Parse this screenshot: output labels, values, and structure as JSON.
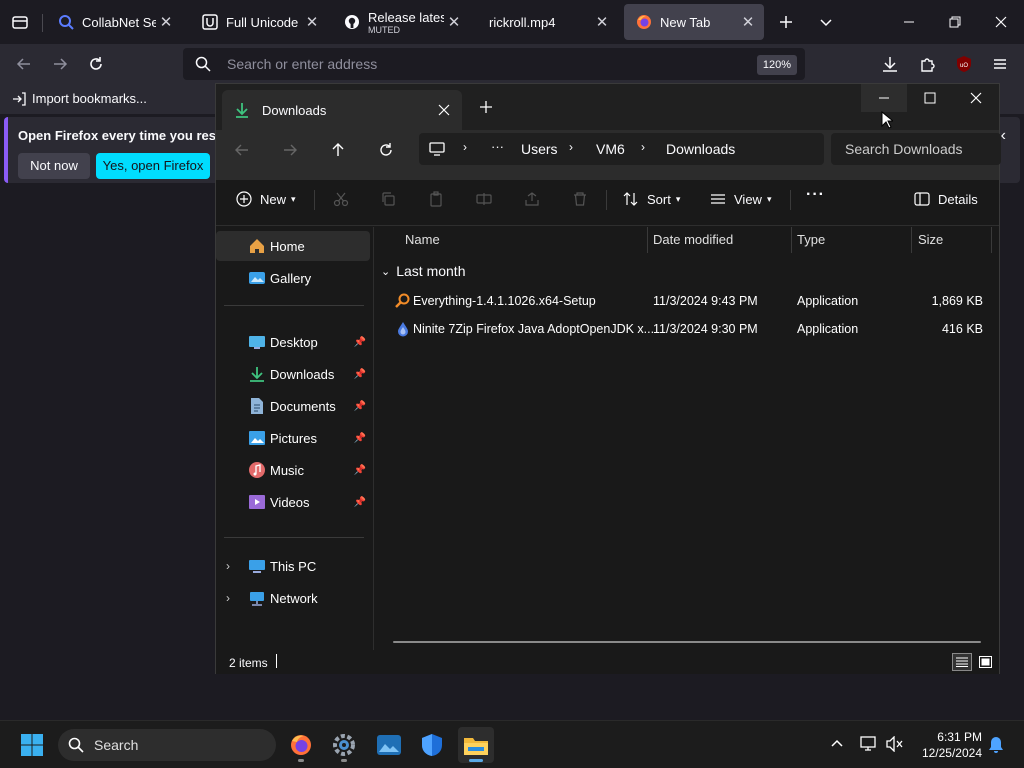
{
  "browser": {
    "tabs": [
      {
        "title": "CollabNet Sear",
        "icon": "search-icon",
        "active": false
      },
      {
        "title": "Full Unicode Inp",
        "icon": "unicode-icon",
        "active": false
      },
      {
        "title": "Release latest · S",
        "subtitle": "MUTED",
        "icon": "github-icon",
        "active": false
      },
      {
        "title": "rickroll.mp4",
        "icon": "",
        "active": false
      },
      {
        "title": "New Tab",
        "icon": "firefox-icon",
        "active": true
      }
    ],
    "address_placeholder": "Search or enter address",
    "zoom": "120%",
    "import_bookmarks": "Import bookmarks...",
    "notification": {
      "text": "Open Firefox every time you restar",
      "not_now": "Not now",
      "yes_open": "Yes, open Firefox"
    },
    "colors": {
      "accent": "#00ddff",
      "chrome": "#2b2a33",
      "tabstrip": "#1c1b22"
    }
  },
  "explorer": {
    "tab_title": "Downloads",
    "breadcrumbs": [
      "Users",
      "VM6",
      "Downloads"
    ],
    "search_placeholder": "Search Downloads",
    "toolbar": {
      "new": "New",
      "sort": "Sort",
      "view": "View",
      "details": "Details"
    },
    "nav": {
      "home": "Home",
      "gallery": "Gallery",
      "quick": [
        {
          "label": "Desktop",
          "icon": "desktop-icon"
        },
        {
          "label": "Downloads",
          "icon": "downloads-icon"
        },
        {
          "label": "Documents",
          "icon": "documents-icon"
        },
        {
          "label": "Pictures",
          "icon": "pictures-icon"
        },
        {
          "label": "Music",
          "icon": "music-icon"
        },
        {
          "label": "Videos",
          "icon": "videos-icon"
        }
      ],
      "this_pc": "This PC",
      "network": "Network"
    },
    "columns": {
      "name": "Name",
      "date": "Date modified",
      "type": "Type",
      "size": "Size"
    },
    "group": "Last month",
    "files": [
      {
        "name": "Everything-1.4.1.1026.x64-Setup",
        "date": "11/3/2024 9:43 PM",
        "type": "Application",
        "size": "1,869 KB",
        "icon": "everything-icon"
      },
      {
        "name": "Ninite 7Zip Firefox Java AdoptOpenJDK x...",
        "date": "11/3/2024 9:30 PM",
        "type": "Application",
        "size": "416 KB",
        "icon": "ninite-icon"
      }
    ],
    "status": "2 items"
  },
  "taskbar": {
    "search": "Search",
    "time": "6:31 PM",
    "date": "12/25/2024"
  }
}
